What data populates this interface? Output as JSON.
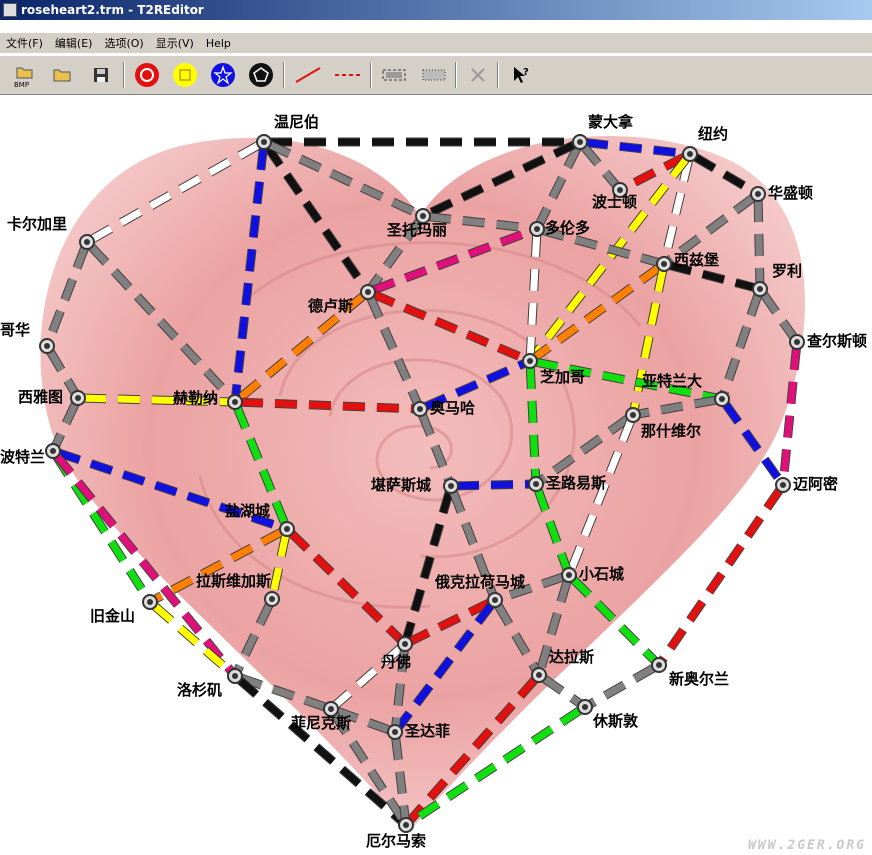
{
  "window": {
    "title": "roseheart2.trm - T2REditor"
  },
  "menu": [
    {
      "label": "文件(F)"
    },
    {
      "label": "编辑(E)"
    },
    {
      "label": "选项(O)"
    },
    {
      "label": "显示(V)"
    },
    {
      "label": "Help"
    }
  ],
  "toolbar": {
    "bmp_label": "BMP",
    "icons": [
      "open-bmp-icon",
      "open-file-icon",
      "save-icon",
      "red-circle-icon",
      "yellow-square-icon",
      "blue-star-icon",
      "black-pentagon-icon",
      "line-icon",
      "dashed-line-icon",
      "rect-select-icon",
      "dotted-rect-icon",
      "delete-icon",
      "help-pointer-icon"
    ]
  },
  "colors": {
    "gray": "#808080",
    "red": "#e31010",
    "yellow": "#ffff00",
    "blue": "#1010e0",
    "black": "#111111",
    "white": "#ffffff",
    "green": "#10e010",
    "orange": "#ff8000",
    "pink": "#e0107a"
  },
  "cities": [
    {
      "name": "温尼伯"
    },
    {
      "name": "蒙大拿"
    },
    {
      "name": "纽约"
    },
    {
      "name": "卡尔加里"
    },
    {
      "name": "圣托玛丽"
    },
    {
      "name": "多伦多"
    },
    {
      "name": "波士顿"
    },
    {
      "name": "华盛顿"
    },
    {
      "name": "西兹堡"
    },
    {
      "name": "罗利"
    },
    {
      "name": "德卢斯"
    },
    {
      "name": "哥华"
    },
    {
      "name": "查尔斯顿"
    },
    {
      "name": "芝加哥"
    },
    {
      "name": "西雅图"
    },
    {
      "name": "赫勒纳"
    },
    {
      "name": "奥马哈"
    },
    {
      "name": "亚特兰大"
    },
    {
      "name": "那什维尔"
    },
    {
      "name": "波特兰"
    },
    {
      "name": "堪萨斯城"
    },
    {
      "name": "圣路易斯"
    },
    {
      "name": "迈阿密"
    },
    {
      "name": "盐湖城"
    },
    {
      "name": "小石城"
    },
    {
      "name": "俄克拉荷马城"
    },
    {
      "name": "旧金山"
    },
    {
      "name": "拉斯维加斯"
    },
    {
      "name": "丹佛"
    },
    {
      "name": "达拉斯"
    },
    {
      "name": "新奥尔兰"
    },
    {
      "name": "洛杉矶"
    },
    {
      "name": "菲尼克斯"
    },
    {
      "name": "休斯敦"
    },
    {
      "name": "圣达菲"
    },
    {
      "name": "厄尔马索"
    }
  ],
  "routes": [
    {
      "from": "温尼伯",
      "to": "卡尔加里",
      "color": "white"
    },
    {
      "from": "温尼伯",
      "to": "蒙大拿",
      "color": "black"
    },
    {
      "from": "温尼伯",
      "to": "德卢斯",
      "color": "black"
    },
    {
      "from": "温尼伯",
      "to": "圣托玛丽",
      "color": "gray"
    },
    {
      "from": "温尼伯",
      "to": "赫勒纳",
      "color": "blue"
    },
    {
      "from": "蒙大拿",
      "to": "纽约",
      "color": "blue"
    },
    {
      "from": "蒙大拿",
      "to": "波士顿",
      "color": "gray"
    },
    {
      "from": "蒙大拿",
      "to": "多伦多",
      "color": "gray"
    },
    {
      "from": "蒙大拿",
      "to": "圣托玛丽",
      "color": "black"
    },
    {
      "from": "纽约",
      "to": "波士顿",
      "color": "red"
    },
    {
      "from": "纽约",
      "to": "华盛顿",
      "color": "black"
    },
    {
      "from": "纽约",
      "to": "西兹堡",
      "color": "white"
    },
    {
      "from": "纽约",
      "to": "芝加哥",
      "color": "yellow"
    },
    {
      "from": "卡尔加里",
      "to": "哥华",
      "color": "gray"
    },
    {
      "from": "卡尔加里",
      "to": "赫勒纳",
      "color": "gray"
    },
    {
      "from": "圣托玛丽",
      "to": "德卢斯",
      "color": "gray"
    },
    {
      "from": "圣托玛丽",
      "to": "多伦多",
      "color": "gray"
    },
    {
      "from": "德卢斯",
      "to": "多伦多",
      "color": "pink"
    },
    {
      "from": "德卢斯",
      "to": "赫勒纳",
      "color": "orange"
    },
    {
      "from": "德卢斯",
      "to": "芝加哥",
      "color": "red"
    },
    {
      "from": "德卢斯",
      "to": "奥马哈",
      "color": "gray"
    },
    {
      "from": "多伦多",
      "to": "芝加哥",
      "color": "white"
    },
    {
      "from": "多伦多",
      "to": "西兹堡",
      "color": "gray"
    },
    {
      "from": "华盛顿",
      "to": "罗利",
      "color": "gray"
    },
    {
      "from": "华盛顿",
      "to": "西兹堡",
      "color": "gray"
    },
    {
      "from": "西兹堡",
      "to": "罗利",
      "color": "black"
    },
    {
      "from": "西兹堡",
      "to": "芝加哥",
      "color": "orange"
    },
    {
      "from": "西兹堡",
      "to": "那什维尔",
      "color": "yellow"
    },
    {
      "from": "罗利",
      "to": "查尔斯顿",
      "color": "gray"
    },
    {
      "from": "罗利",
      "to": "亚特兰大",
      "color": "gray"
    },
    {
      "from": "查尔斯顿",
      "to": "迈阿密",
      "color": "pink"
    },
    {
      "from": "哥华",
      "to": "西雅图",
      "color": "gray"
    },
    {
      "from": "西雅图",
      "to": "赫勒纳",
      "color": "yellow"
    },
    {
      "from": "西雅图",
      "to": "波特兰",
      "color": "gray"
    },
    {
      "from": "赫勒纳",
      "to": "奥马哈",
      "color": "red"
    },
    {
      "from": "赫勒纳",
      "to": "盐湖城",
      "color": "green"
    },
    {
      "from": "奥马哈",
      "to": "芝加哥",
      "color": "blue"
    },
    {
      "from": "奥马哈",
      "to": "堪萨斯城",
      "color": "gray"
    },
    {
      "from": "芝加哥",
      "to": "圣路易斯",
      "color": "green"
    },
    {
      "from": "芝加哥",
      "to": "亚特兰大",
      "color": "green"
    },
    {
      "from": "亚特兰大",
      "to": "迈阿密",
      "color": "blue"
    },
    {
      "from": "亚特兰大",
      "to": "那什维尔",
      "color": "gray"
    },
    {
      "from": "那什维尔",
      "to": "圣路易斯",
      "color": "gray"
    },
    {
      "from": "那什维尔",
      "to": "小石城",
      "color": "white"
    },
    {
      "from": "波特兰",
      "to": "盐湖城",
      "color": "blue"
    },
    {
      "from": "波特兰",
      "to": "旧金山",
      "color": "green"
    },
    {
      "from": "波特兰",
      "to": "洛杉矶",
      "color": "pink"
    },
    {
      "from": "堪萨斯城",
      "to": "圣路易斯",
      "color": "blue"
    },
    {
      "from": "堪萨斯城",
      "to": "丹佛",
      "color": "black"
    },
    {
      "from": "堪萨斯城",
      "to": "俄克拉荷马城",
      "color": "gray"
    },
    {
      "from": "圣路易斯",
      "to": "小石城",
      "color": "green"
    },
    {
      "from": "迈阿密",
      "to": "新奥尔兰",
      "color": "red"
    },
    {
      "from": "盐湖城",
      "to": "旧金山",
      "color": "orange"
    },
    {
      "from": "盐湖城",
      "to": "拉斯维加斯",
      "color": "yellow"
    },
    {
      "from": "盐湖城",
      "to": "丹佛",
      "color": "red"
    },
    {
      "from": "小石城",
      "to": "俄克拉荷马城",
      "color": "gray"
    },
    {
      "from": "小石城",
      "to": "新奥尔兰",
      "color": "green"
    },
    {
      "from": "小石城",
      "to": "达拉斯",
      "color": "gray"
    },
    {
      "from": "俄克拉荷马城",
      "to": "丹佛",
      "color": "red"
    },
    {
      "from": "俄克拉荷马城",
      "to": "达拉斯",
      "color": "gray"
    },
    {
      "from": "俄克拉荷马城",
      "to": "圣达菲",
      "color": "blue"
    },
    {
      "from": "旧金山",
      "to": "洛杉矶",
      "color": "yellow"
    },
    {
      "from": "拉斯维加斯",
      "to": "洛杉矶",
      "color": "gray"
    },
    {
      "from": "丹佛",
      "to": "菲尼克斯",
      "color": "white"
    },
    {
      "from": "丹佛",
      "to": "圣达菲",
      "color": "gray"
    },
    {
      "from": "达拉斯",
      "to": "休斯敦",
      "color": "gray"
    },
    {
      "from": "达拉斯",
      "to": "厄尔马索",
      "color": "red"
    },
    {
      "from": "新奥尔兰",
      "to": "休斯敦",
      "color": "gray"
    },
    {
      "from": "洛杉矶",
      "to": "菲尼克斯",
      "color": "gray"
    },
    {
      "from": "洛杉矶",
      "to": "厄尔马索",
      "color": "black"
    },
    {
      "from": "菲尼克斯",
      "to": "圣达菲",
      "color": "gray"
    },
    {
      "from": "菲尼克斯",
      "to": "厄尔马索",
      "color": "gray"
    },
    {
      "from": "休斯敦",
      "to": "厄尔马索",
      "color": "green"
    },
    {
      "from": "圣达菲",
      "to": "厄尔马索",
      "color": "gray"
    }
  ],
  "watermark": "WWW.2GER.ORG"
}
